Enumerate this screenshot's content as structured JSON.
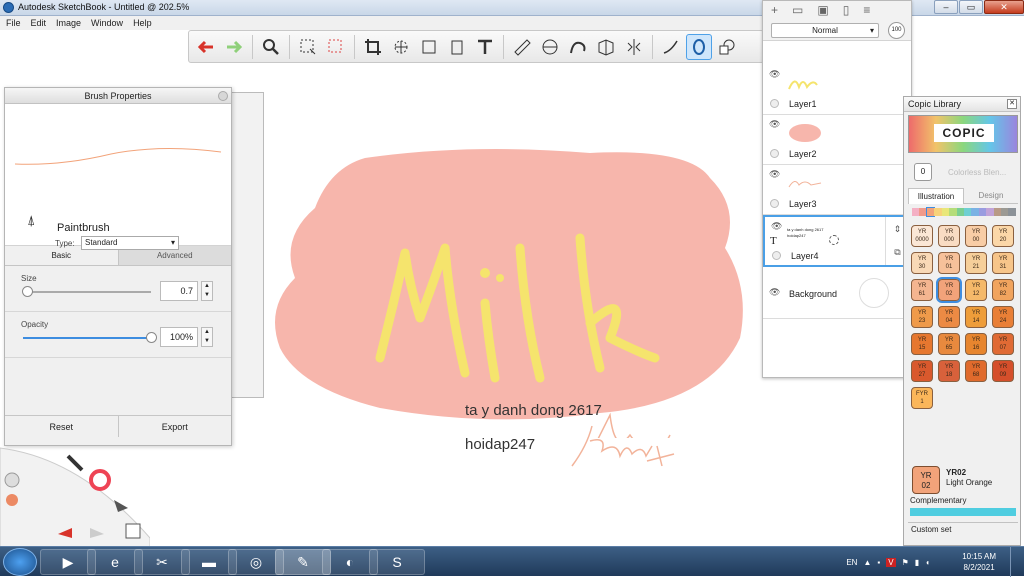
{
  "window": {
    "title": "Autodesk SketchBook - Untitled @ 202.5%"
  },
  "menu": [
    "File",
    "Edit",
    "Image",
    "Window",
    "Help"
  ],
  "toolbar": {
    "tools": [
      "undo-icon",
      "redo-icon",
      "zoom-icon",
      "select-icon",
      "lasso-icon",
      "crop-icon",
      "transform-icon",
      "distort-icon",
      "fill-icon",
      "text-icon",
      "ruler-icon",
      "ellipse-guide-icon",
      "french-curve-icon",
      "perspective-icon",
      "symmetry-icon",
      "stroke-icon",
      "predictive-stroke-icon",
      "copic-icon"
    ]
  },
  "layers": {
    "blend_mode": "Normal",
    "opacity": "100",
    "items": [
      {
        "name": "Layer1"
      },
      {
        "name": "Layer2"
      },
      {
        "name": "Layer3"
      },
      {
        "name": "Layer4",
        "thumb_text": "ta y danh dong 2617 hoidap247"
      }
    ],
    "background": "Background"
  },
  "brush": {
    "title": "Brush Properties",
    "name": "Paintbrush",
    "type_label": "Type:",
    "type_value": "Standard",
    "tab_basic": "Basic",
    "tab_advanced": "Advanced",
    "size_label": "Size",
    "size_value": "0.7",
    "size_fraction": 0.03,
    "opacity_label": "Opacity",
    "opacity_value": "100%",
    "opacity_fraction": 1.0,
    "reset": "Reset",
    "export": "Export"
  },
  "canvas": {
    "big_word": "Milk",
    "line1": "ta y danh dong 2617",
    "line2": "hoidap247",
    "signature": "lam",
    "colors": {
      "blob": "#f7b6ac",
      "letters": "#f5e46d",
      "signature": "#f2b39a"
    }
  },
  "copic": {
    "title": "Copic Library",
    "logo": "COPIC",
    "colorless_code": "0",
    "colorless_label": "Colorless Blen...",
    "tab_on": "Illustration",
    "tab_off": "Design",
    "swatches": [
      {
        "c": "YR",
        "n": "0000",
        "color": "#fbe7d6"
      },
      {
        "c": "YR",
        "n": "000",
        "color": "#f9dcc3"
      },
      {
        "c": "YR",
        "n": "00",
        "color": "#f8cda6"
      },
      {
        "c": "YR",
        "n": "20",
        "color": "#fbd7a8"
      },
      {
        "c": "YR",
        "n": "30",
        "color": "#f9d9b6"
      },
      {
        "c": "YR",
        "n": "01",
        "color": "#f7c19a"
      },
      {
        "c": "YR",
        "n": "21",
        "color": "#f6cf9a"
      },
      {
        "c": "YR",
        "n": "31",
        "color": "#f7c58a"
      },
      {
        "c": "YR",
        "n": "61",
        "color": "#f4b590"
      },
      {
        "c": "YR",
        "n": "02",
        "color": "#f2a37a",
        "sel": true
      },
      {
        "c": "YR",
        "n": "12",
        "color": "#f5b96a"
      },
      {
        "c": "YR",
        "n": "82",
        "color": "#f1a45e"
      },
      {
        "c": "YR",
        "n": "23",
        "color": "#ef9a4a"
      },
      {
        "c": "YR",
        "n": "04",
        "color": "#ec8a44"
      },
      {
        "c": "YR",
        "n": "14",
        "color": "#ee9d3a"
      },
      {
        "c": "YR",
        "n": "24",
        "color": "#e97f36"
      },
      {
        "c": "YR",
        "n": "15",
        "color": "#e6772f"
      },
      {
        "c": "YR",
        "n": "65",
        "color": "#e8893e"
      },
      {
        "c": "YR",
        "n": "16",
        "color": "#e7852e"
      },
      {
        "c": "YR",
        "n": "07",
        "color": "#e06a34"
      },
      {
        "c": "YR",
        "n": "27",
        "color": "#d9592d"
      },
      {
        "c": "YR",
        "n": "18",
        "color": "#d8613b"
      },
      {
        "c": "YR",
        "n": "68",
        "color": "#e06a2c"
      },
      {
        "c": "YR",
        "n": "09",
        "color": "#d54f2b"
      },
      {
        "c": "FYR",
        "n": "1",
        "color": "#fbb65a"
      }
    ],
    "selected_code": "YR02",
    "selected_name": "Light Orange",
    "selected_badge_c": "YR",
    "selected_badge_n": "02",
    "complementary": "Complementary",
    "custom_set": "Custom set"
  },
  "taskbar": {
    "lang": "EN",
    "time": "10:15 AM",
    "date": "8/2/2021"
  }
}
